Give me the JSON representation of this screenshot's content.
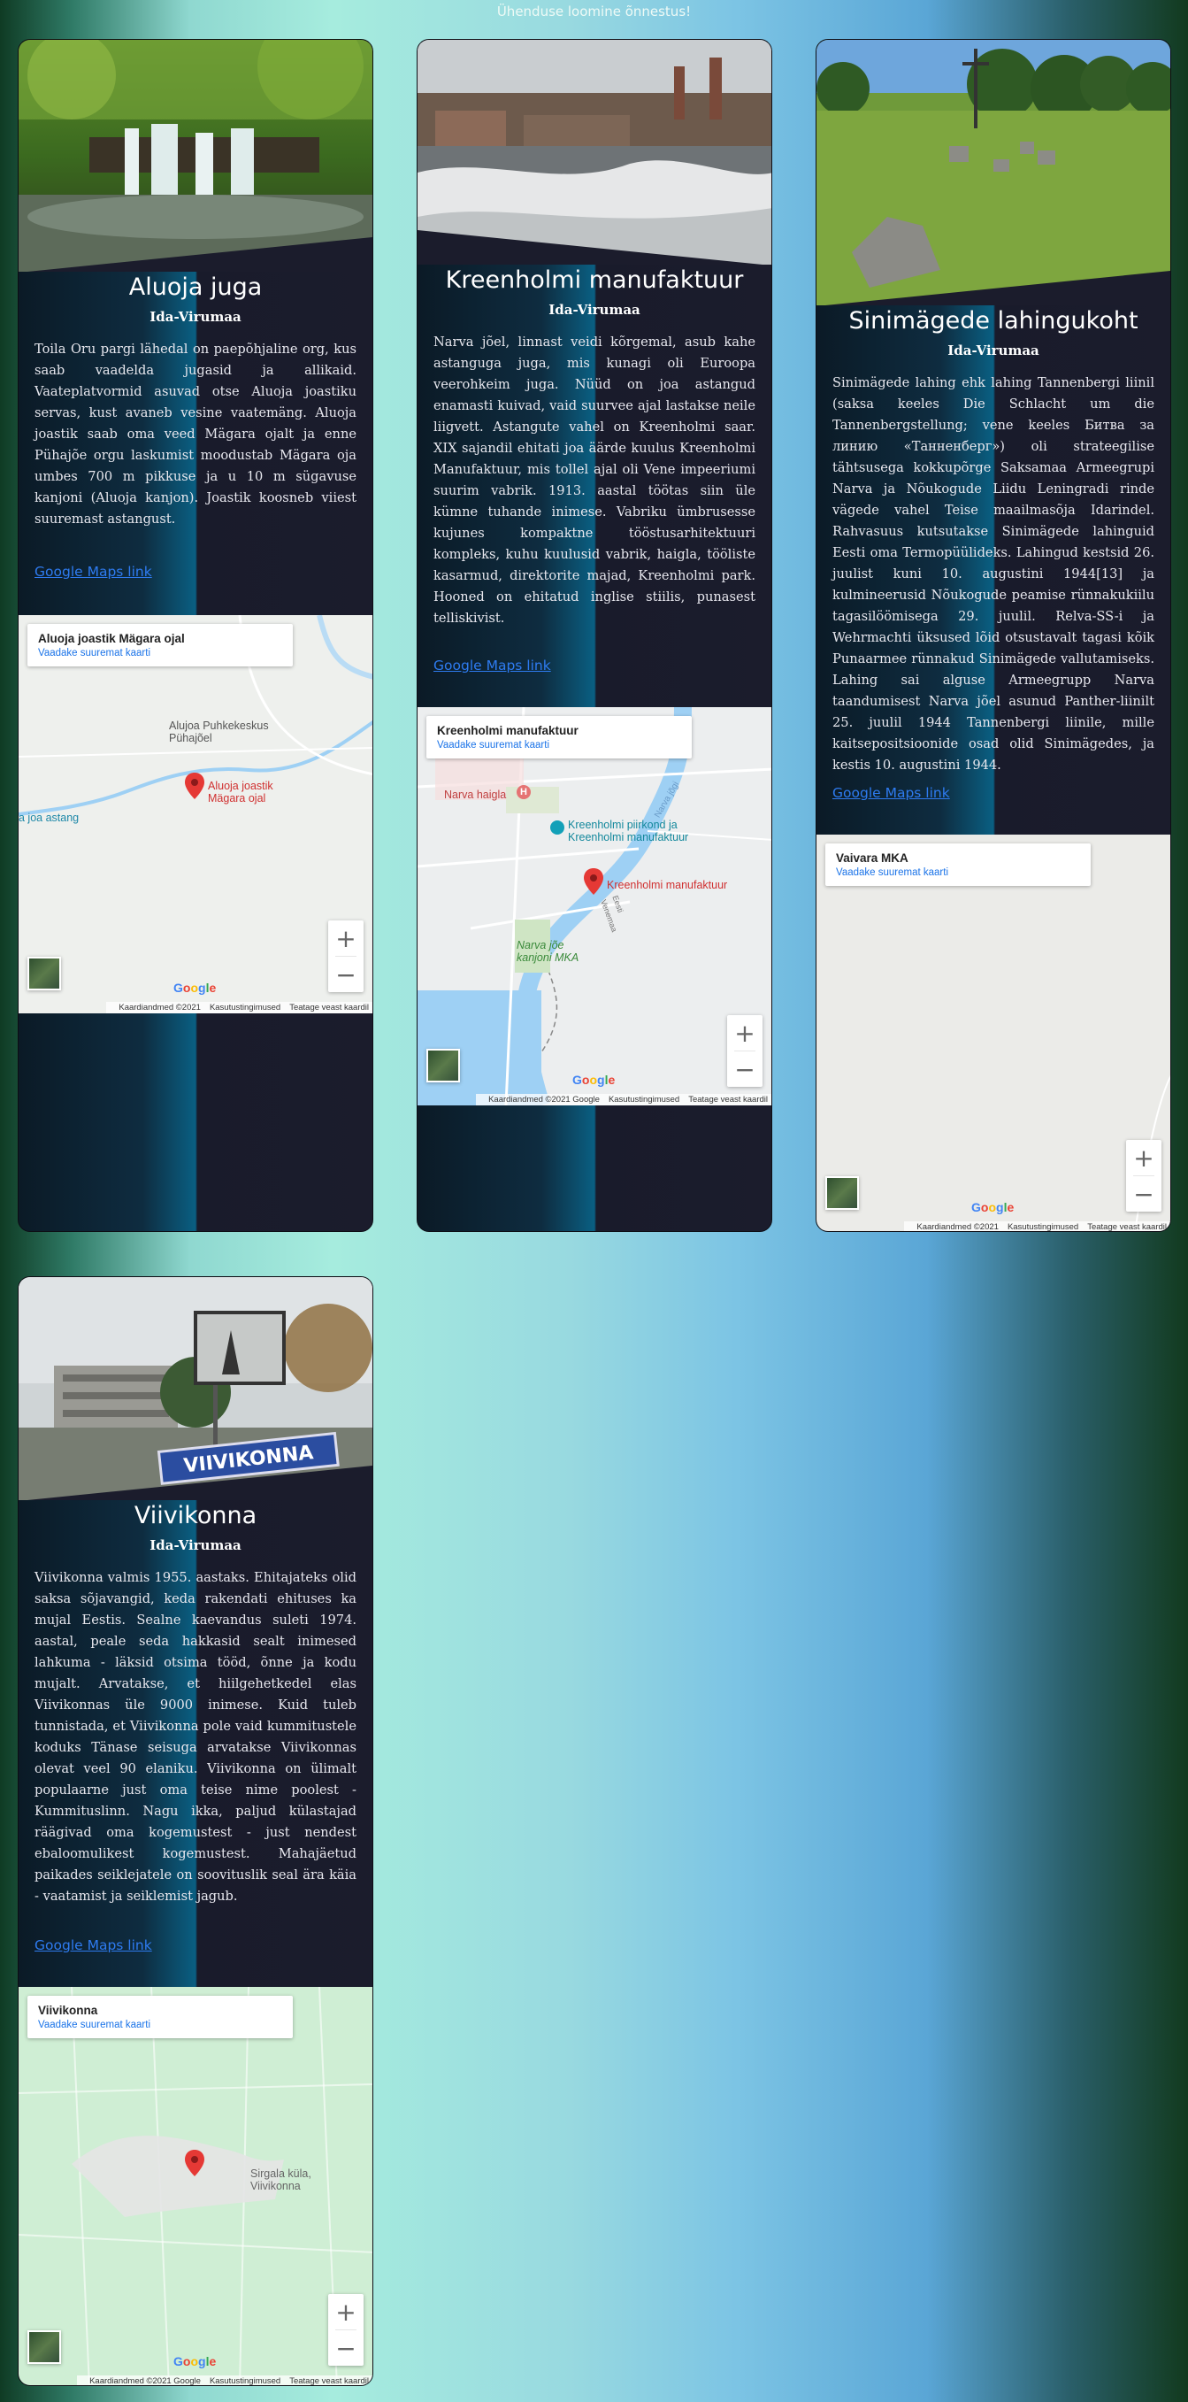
{
  "status": "Ühenduse loomine õnnestus!",
  "accent_colors": {
    "link": "#2e7bf0",
    "card_bg": "#1b1c2c",
    "pin": "#e53935"
  },
  "map_common": {
    "larger_map": "Vaadake suuremat kaarti",
    "data": "Kaardiandmed ©2021",
    "data_google": "Kaardiandmed ©2021 Google",
    "terms": "Kasutustingimused",
    "report": "Teatage veast kaardil",
    "zoom_in": "+",
    "zoom_out": "−",
    "logo": [
      "G",
      "o",
      "o",
      "g",
      "l",
      "e"
    ]
  },
  "cards": [
    {
      "title": "Aluoja juga",
      "region": "Ida-Virumaa",
      "text": "Toila Oru pargi lähedal on paepõhjaline org, kus saab vaadelda jugasid ja allikaid. Vaateplatvormid asuvad otse Aluoja joastiku servas, kust avaneb vesine vaatemäng. Aluoja joastik saab oma veed Mägara ojalt ja enne Pühajõe orgu laskumist moodustab Mägara oja umbes 700 m pikkuse ja u 10 m sügavuse kanjoni (Aluoja kanjon). Joastik koosneb viiest suuremast astangust.",
      "link": "Google Maps link",
      "map": {
        "place": "Aluoja joastik Mägara ojal",
        "pin_label": "Aluoja joastik Mägara ojal",
        "poi_1": "Alujoa Puhkekeskus Pühajõel",
        "poi_2": "a joa astang"
      }
    },
    {
      "title": "Kreenholmi manufaktuur",
      "region": "Ida-Virumaa",
      "text": "Narva jõel, linnast veidi kõrgemal, asub kahe astanguga juga, mis kunagi oli Euroopa veerohkeim juga. Nüüd on joa astangud enamasti kuivad, vaid suurvee ajal lastakse neile liigvett. Astangute vahel on Kreenholmi saar. XIX sajandil ehitati joa äärde kuulus Kreenholmi Manufaktuur, mis tollel ajal oli Vene impeeriumi suurim vabrik. 1913. aastal töötas siin üle kümne tuhande inimese. Vabriku ümbrusesse kujunes kompaktne tööstusarhitektuuri kompleks, kuhu kuulusid vabrik, haigla, tööliste kasarmud, direktorite majad, Kreenholmi park. Hooned on ehitatud inglise stiilis, punasest telliskivist.",
      "link": "Google Maps link",
      "map": {
        "place": "Kreenholmi manufaktuur",
        "pin_label": "Kreenholmi manufaktuur",
        "poi_1": "Narva haigla",
        "poi_2": "Kreenholmi piirkond ja Kreenholmi manufaktuur",
        "poi_3": "Narva jõe kanjoni MKA",
        "river": "Narva jõgi",
        "road": "Eesti Venemaa"
      }
    },
    {
      "title": "Sinimägede lahingukoht",
      "region": "Ida-Virumaa",
      "text": "Sinimägede lahing ehk lahing Tannenbergi liinil (saksa keeles Die Schlacht um die Tannenbergstellung; vene keeles Битва за линию «Танненберг») oli strateegilise tähtsusega kokkupõrge Saksamaa Armeegrupi Narva ja Nõukogude Liidu Leningradi rinde vägede vahel Teise maailmasõja Idarindel. Rahvasuus kutsutakse Sinimägede lahinguid Eesti oma Termopüülideks. Lahingud kestsid 26. juulist kuni 10. augustini 1944[13] ja kulmineerusid Nõukogude peamise rünnakukiilu tagasilöömisega 29. juulil. Relva-SS-i ja Wehrmachti üksused lõid otsustavalt tagasi kõik Punaarmee rünnakud Sinimägede vallutamiseks. Lahing sai alguse Armeegrupp Narva taandumisest Narva jõel asunud Panther-liinilt 25. juulil 1944 Tannenbergi liinile, mille kaitsepositsioonide osad olid Sinimägedes, ja kestis 10. augustini 1944.",
      "link": "Google Maps link",
      "map": {
        "place": "Vaivara MKA"
      }
    },
    {
      "title": "Viivikonna",
      "region": "Ida-Virumaa",
      "text": "Viivikonna valmis 1955. aastaks. Ehitajateks olid saksa sõjavangid, keda rakendati ehituses ka mujal Eestis. Sealne kaevandus suleti 1974. aastal, peale seda hakkasid sealt inimesed lahkuma - läksid otsima tööd, õnne ja kodu mujalt. Arvatakse, et hiilgehetkedel elas Viivikonnas üle 9000 inimese. Kuid tuleb tunnistada, et Viivikonna pole vaid kummitustele koduks Tänase seisuga arvatakse Viivikonnas olevat veel 90 elaniku. Viivikonna on ülimalt populaarne just oma teise nime poolest - Kummituslinn. Nagu ikka, paljud külastajad räägivad oma kogemustest - just nendest ebaloomulikest kogemustest. Mahajäetud paikades seiklejatele on soovituslik seal ära käia - vaatamist ja seiklemist jagub.",
      "link": "Google Maps link",
      "map": {
        "place": "Viivikonna",
        "poi_1": "Sirgala küla, Viivikonna"
      }
    }
  ],
  "sign_text": "VIIVIKONNA"
}
